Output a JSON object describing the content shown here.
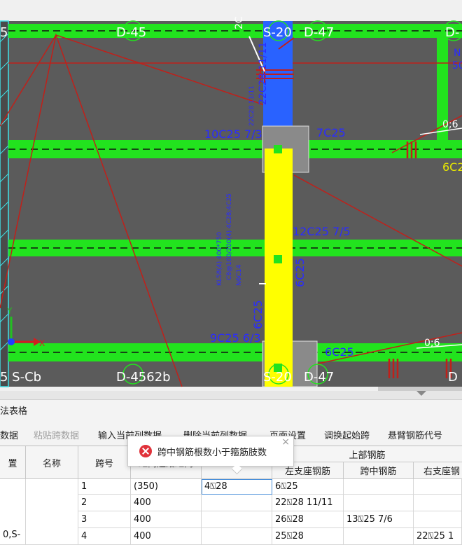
{
  "drawing": {
    "labels": {
      "beam_left": "D-45",
      "beam_s20_top": "S-20",
      "beam_d47_top": "D-47",
      "beam_right_top": "D-",
      "beam_edge_top": "5",
      "beam_bottom_scb": "5 S-Cb",
      "beam_bottom_d45": "D-4562b",
      "beam_bottom_s20": "S-20",
      "beam_bottom_d47": "D-47",
      "beam_bottom_right": "D",
      "rebar_10c25": "10C25 7/3",
      "rebar_7c25": "7C25",
      "rebar_12c25": "12C25 7/5",
      "rebar_9c25": "9C25 6/3",
      "rebar_6c25_bottom": "6C25",
      "rebar_6c25_vert": "6C25",
      "rebar_6c25_vert2": "6C25",
      "rebar_22c28_vert": "22C28 11/11",
      "right_06_top": "0;6",
      "right_06_bottom": "0;6",
      "right_6c2": "6C2",
      "right_n": "N",
      "right_50": "50",
      "top_2c": "2C",
      "small_vert_text": "KL58(4) 400*750",
      "small_vert_text2": "C8@100/200(4) 4C28;4C25",
      "small_vert_text3": "N6C14",
      "small_vert_text4": "22C28 11/11",
      "axis_x": "X",
      "axis_y": "Y"
    },
    "colors": {
      "background": "#5b5b5b",
      "beam": "#22e31e",
      "column": "#ffff00",
      "column_top": "#2962ff",
      "rebar_text": "#2a2cff",
      "cyan": "#3fe0e6",
      "red_line": "#c0201a"
    }
  },
  "panel": {
    "title": "法表格",
    "toolbar": [
      {
        "label": "数据",
        "enabled": true
      },
      {
        "label": "粘贴跨数据",
        "enabled": false
      },
      {
        "label": "输入当前列数据",
        "enabled": true
      },
      {
        "label": "删除当前列数据",
        "enabled": true
      },
      {
        "label": "页面设置",
        "enabled": true
      },
      {
        "label": "调换起始跨",
        "enabled": true
      },
      {
        "label": "悬臂钢筋代号",
        "enabled": true
      }
    ],
    "headers": {
      "position": "置",
      "name": "名称",
      "span": "跨号",
      "span_len": "距离起始距离",
      "col5": "",
      "group_top": "上部钢筋",
      "left_support": "左支座钢筋",
      "mid": "跨中钢筋",
      "right_support": "右支座钢"
    },
    "rows": [
      {
        "position": "",
        "name": "",
        "span": "1",
        "len": "(350)",
        "col5": "4⍂28",
        "left": "6⍂25",
        "mid": "",
        "right": ""
      },
      {
        "position": "",
        "name": "",
        "span": "2",
        "len": "400",
        "col5": "",
        "left": "22⍂28 11/11",
        "mid": "",
        "right": ""
      },
      {
        "position": "0,S-",
        "name": "",
        "span": "3",
        "len": "400",
        "col5": "",
        "left": "26⍂28",
        "mid": "13⍂25 7/6",
        "right": ""
      },
      {
        "position": "",
        "name": "",
        "span": "4",
        "len": "400",
        "col5": "",
        "left": "25⍂28",
        "mid": "",
        "right": "22⍂25 1"
      }
    ]
  },
  "tooltip": {
    "message": "跨中钢筋根数小于箍筋肢数",
    "close": "×"
  }
}
